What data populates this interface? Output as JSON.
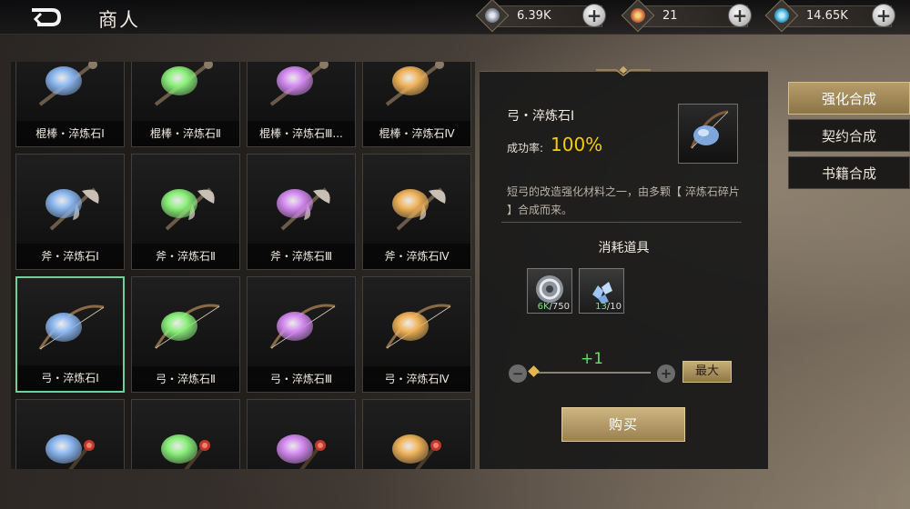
{
  "header": {
    "title": "商人",
    "currencies": [
      {
        "icon": "silver-coin-icon",
        "value": "6.39K",
        "color": "#9aa4b4"
      },
      {
        "icon": "gold-medal-icon",
        "value": "21",
        "color": "#c9673a"
      },
      {
        "icon": "gem-icon",
        "value": "14.65K",
        "color": "#3aa1c9"
      }
    ]
  },
  "grid": {
    "items": [
      {
        "label": "棍棒・淬炼石Ⅰ",
        "color": "#8ab6f0",
        "weapon": "club"
      },
      {
        "label": "棍棒・淬炼石Ⅱ",
        "color": "#8af07a",
        "weapon": "club"
      },
      {
        "label": "棍棒・淬炼石Ⅲ...",
        "color": "#d48af0",
        "weapon": "club"
      },
      {
        "label": "棍棒・淬炼石Ⅳ",
        "color": "#f0b35a",
        "weapon": "club"
      },
      {
        "label": "斧・淬炼石Ⅰ",
        "color": "#8ab6f0",
        "weapon": "axe"
      },
      {
        "label": "斧・淬炼石Ⅱ",
        "color": "#8af07a",
        "weapon": "axe"
      },
      {
        "label": "斧・淬炼石Ⅲ",
        "color": "#d48af0",
        "weapon": "axe"
      },
      {
        "label": "斧・淬炼石Ⅳ",
        "color": "#f0b35a",
        "weapon": "axe"
      },
      {
        "label": "弓・淬炼石Ⅰ",
        "color": "#8ab6f0",
        "weapon": "bow",
        "selected": true
      },
      {
        "label": "弓・淬炼石Ⅱ",
        "color": "#8af07a",
        "weapon": "bow"
      },
      {
        "label": "弓・淬炼石Ⅲ",
        "color": "#d48af0",
        "weapon": "bow"
      },
      {
        "label": "弓・淬炼石Ⅳ",
        "color": "#f0b35a",
        "weapon": "bow"
      },
      {
        "label": "",
        "color": "#8ab6f0",
        "weapon": "wand"
      },
      {
        "label": "",
        "color": "#8af07a",
        "weapon": "wand"
      },
      {
        "label": "",
        "color": "#d48af0",
        "weapon": "wand"
      },
      {
        "label": "",
        "color": "#f0b35a",
        "weapon": "wand"
      }
    ]
  },
  "detail": {
    "name": "弓・淬炼石Ⅰ",
    "rate_label": "成功率:",
    "rate_value": "100%",
    "description": "短弓的改造强化材料之一，由多颗【 淬炼石碎片 】合成而来。",
    "consume_title": "消耗道具",
    "materials": [
      {
        "icon": "silver-coin-icon",
        "have": "6K",
        "need": "/750"
      },
      {
        "icon": "stone-shard-icon",
        "have": "13",
        "need": "/10"
      }
    ],
    "quantity_text": "+1",
    "minus_label": "−",
    "plus_label": "+",
    "max_label": "最大",
    "buy_label": "购买"
  },
  "tabs": [
    {
      "label": "强化合成",
      "active": true
    },
    {
      "label": "契约合成",
      "active": false
    },
    {
      "label": "书籍合成",
      "active": false
    }
  ],
  "colors": {
    "accent_gold": "#f4d000",
    "selected_border": "#6dcf9a",
    "button_gold": "#b69d6a"
  }
}
